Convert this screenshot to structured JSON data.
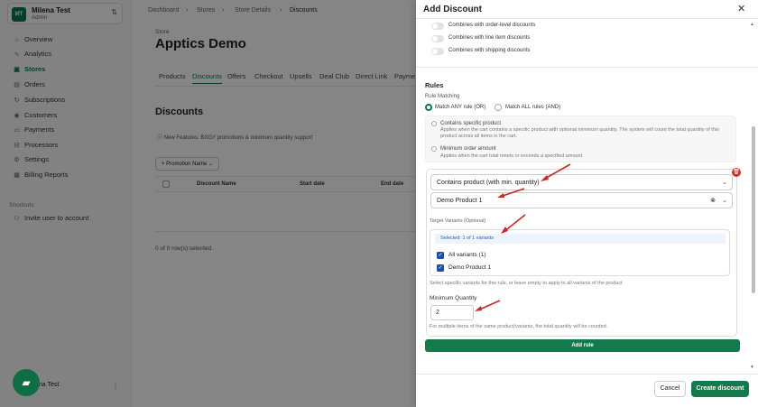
{
  "workspace": {
    "initials": "MT",
    "name": "Milena Test",
    "role": "Admin"
  },
  "sidebar": {
    "items": [
      {
        "label": "Overview",
        "icon": "⌂"
      },
      {
        "label": "Analytics",
        "icon": "∿"
      },
      {
        "label": "Stores",
        "icon": "▣"
      },
      {
        "label": "Orders",
        "icon": "▤"
      },
      {
        "label": "Subscriptions",
        "icon": "↻"
      },
      {
        "label": "Customers",
        "icon": "◉"
      },
      {
        "label": "Payments",
        "icon": "▭"
      },
      {
        "label": "Processors",
        "icon": "⊟"
      },
      {
        "label": "Settings",
        "icon": "⚙"
      },
      {
        "label": "Billing Reports",
        "icon": "▦"
      }
    ],
    "shortcuts_header": "Shortcuts",
    "shortcut": {
      "label": "Invite user to account",
      "icon": "⚇"
    },
    "user": "Milena Test"
  },
  "breadcrumb": [
    "Dashboard",
    "Stores",
    "Store Details",
    "Discounts"
  ],
  "store": {
    "label": "Store",
    "name": "Apptics Demo"
  },
  "tabs": [
    "Products",
    "Discounts",
    "Offers",
    "Checkout",
    "Upsells",
    "Deal Club",
    "Direct Link",
    "Payme"
  ],
  "discounts": {
    "title": "Discounts",
    "feature_note": "New Features: BXGY promotions & minimum quantity support",
    "filter": "+ Promotion Name ⌄",
    "columns": [
      "Discount Name",
      "Start date",
      "End date"
    ],
    "rows_selected": "0 of 0 row(s) selected."
  },
  "drawer": {
    "title": "Add Discount",
    "toggles": [
      "Combines with order-level discounts",
      "Combines with line item discounts",
      "Combines with shipping discounts"
    ],
    "rules_title": "Rules",
    "rule_matching_label": "Rule Matching",
    "match_any": "Match ANY rule (OR)",
    "match_all": "Match ALL rules (AND)",
    "options": [
      {
        "title": "Contains specific product",
        "desc": "Applies when the cart contains a specific product with optional minimum quantity. The system will count the total quantity of this product across all items in the cart."
      },
      {
        "title": "Minimum order amount",
        "desc": "Applies when the cart total meets or exceeds a specified amount."
      }
    ],
    "rule_type": "Contains product (with min. quantity)",
    "product": "Demo Product 1",
    "target_variants_label": "Target Variants (Optional)",
    "selected_variants": "Selected: 1 of 1 variants",
    "variants": [
      "All variants (1)",
      "Demo Product 1"
    ],
    "variants_help": "Select specific variants for this rule, or leave empty to apply to all variants of the product",
    "min_qty_label": "Minimum Quantity",
    "min_qty_value": "2",
    "min_qty_help": "For multiple items of the same product/variants, the total quantity will be counted.",
    "add_rule": "Add rule",
    "cancel": "Cancel",
    "create": "Create discount"
  },
  "colors": {
    "brand": "#137a4c",
    "annotation": "#c62828",
    "danger": "#d32f2f",
    "info": "#2a5db0"
  }
}
